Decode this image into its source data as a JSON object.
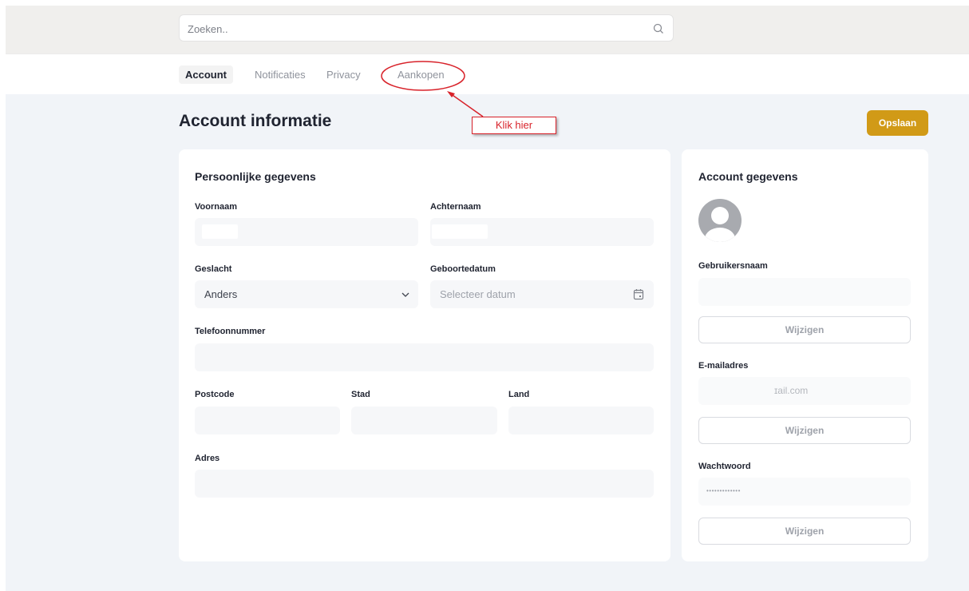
{
  "search": {
    "placeholder": "Zoeken..",
    "icon": "search-icon"
  },
  "tabs": [
    {
      "label": "Account",
      "active": true
    },
    {
      "label": "Notificaties"
    },
    {
      "label": "Privacy"
    },
    {
      "label": "Aankopen"
    }
  ],
  "page": {
    "title": "Account informatie",
    "save_label": "Opslaan"
  },
  "personal": {
    "title": "Persoonlijke gegevens",
    "first_name_label": "Voornaam",
    "last_name_label": "Achternaam",
    "gender_label": "Geslacht",
    "gender_value": "Anders",
    "birthdate_label": "Geboortedatum",
    "birthdate_placeholder": "Selecteer datum",
    "phone_label": "Telefoonnummer",
    "postcode_label": "Postcode",
    "city_label": "Stad",
    "country_label": "Land",
    "address_label": "Adres"
  },
  "account": {
    "title": "Account gegevens",
    "username_label": "Gebruikersnaam",
    "email_label": "E-mailadres",
    "email_value": "ɪail.com",
    "password_label": "Wachtwoord",
    "password_value": "•••••••••••••",
    "change_label": "Wijzigen"
  },
  "annotation": {
    "text": "Klik hier"
  },
  "colors": {
    "accent": "#d19a17",
    "annotation": "#d8222a"
  }
}
